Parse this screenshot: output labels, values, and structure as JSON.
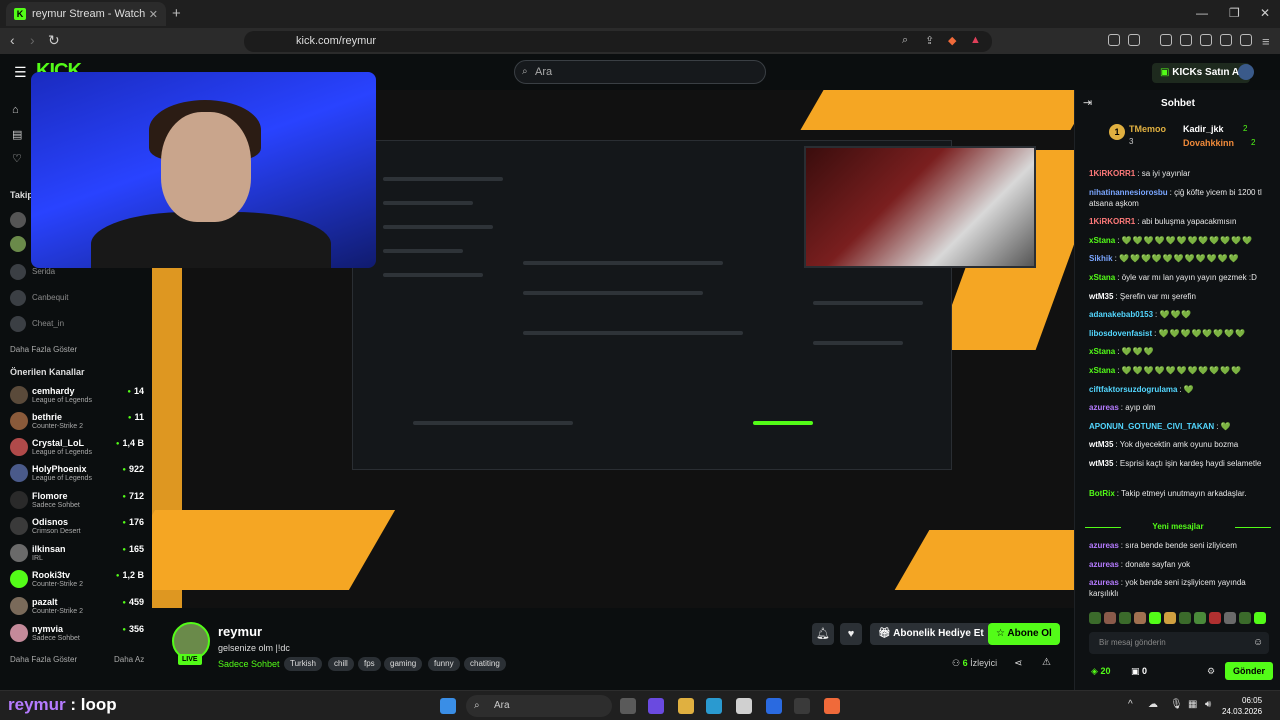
{
  "browser": {
    "tab_title": "reymur Stream - Watch Live on K",
    "url": "kick.com/reymur"
  },
  "header": {
    "logo": "KICK",
    "search_placeholder": "Ara",
    "kicks_button": "KICKs Satın Al"
  },
  "sidebar": {
    "following_title": "Takip",
    "offline_channels": [
      "Serida",
      "Canbequit",
      "Cheat_in"
    ],
    "show_more": "Daha Fazla Göster",
    "recommended_title": "Önerilen Kanallar",
    "recommended": [
      {
        "name": "cemhardy",
        "category": "League of Legends",
        "viewers": "14",
        "color": "#5a4a3a"
      },
      {
        "name": "bethrie",
        "category": "Counter-Strike 2",
        "viewers": "11",
        "color": "#8a5a3a"
      },
      {
        "name": "Crystal_LoL",
        "category": "League of Legends",
        "viewers": "1,4 B",
        "color": "#b04a4a"
      },
      {
        "name": "HolyPhoenix",
        "category": "League of Legends",
        "viewers": "922",
        "color": "#4a5a8a"
      },
      {
        "name": "Flomore",
        "category": "Sadece Sohbet",
        "viewers": "712",
        "color": "#2a2a2a"
      },
      {
        "name": "Odisnos",
        "category": "Crimson Desert",
        "viewers": "176",
        "color": "#3a3a3a"
      },
      {
        "name": "ilkinsan",
        "category": "IRL",
        "viewers": "165",
        "color": "#6a6a6a"
      },
      {
        "name": "Rooki3tv",
        "category": "Counter-Strike 2",
        "viewers": "1,2 B",
        "color": "#53fc18"
      },
      {
        "name": "pazalt",
        "category": "Counter-Strike 2",
        "viewers": "459",
        "color": "#7a6a5a"
      },
      {
        "name": "nymvia",
        "category": "Sadece Sohbet",
        "viewers": "356",
        "color": "#c48a9a"
      }
    ],
    "show_more_2": "Daha Fazla Göster",
    "show_less": "Daha Az"
  },
  "stream": {
    "streamer": "reymur",
    "live_badge": "LIVE",
    "title": "gelsenize olm |!dc",
    "category": "Sadece Sohbet",
    "tags": [
      "Turkish",
      "chill",
      "fps",
      "gaming",
      "funny",
      "chatiting"
    ],
    "gift_button": "Abonelik Hediye Et",
    "subscribe_button": "Abone Ol",
    "viewer_count": "6",
    "viewer_label": "İzleyici"
  },
  "chat": {
    "title": "Sohbet",
    "pinned": {
      "leader": "TMemoo",
      "leader_count": "3",
      "users": [
        {
          "name": "Kadir_jkk",
          "count": "2"
        },
        {
          "name": "Dovahkkinn",
          "count": "2"
        }
      ]
    },
    "messages": [
      {
        "user": "1KiRKORR1",
        "text": "sa iyi yayınlar",
        "color": "#ff7a7a"
      },
      {
        "user": "nihatinannesiorosbu",
        "text": "çiğ köfte yicem bi 1200 tl atsana aşkom",
        "color": "#7aa6ff"
      },
      {
        "user": "1KiRKORR1",
        "text": "abi buluşma yapacakmısın",
        "color": "#ff7a7a"
      },
      {
        "user": "xStana",
        "text": "💚💚💚💚💚💚💚💚💚💚💚💚",
        "color": "#53fc18"
      },
      {
        "user": "Sikhik",
        "text": "💚💚💚💚💚💚💚💚💚💚💚",
        "color": "#7aa6ff"
      },
      {
        "user": "xStana",
        "text": "öyle var mı lan yayın yayın gezmek :D",
        "color": "#53fc18"
      },
      {
        "user": "wtM35",
        "text": "Şerefin var mı şerefin",
        "color": "#ffffff"
      },
      {
        "user": "adanakebab0153",
        "text": "💚💚💚",
        "color": "#53d7ff"
      },
      {
        "user": "libosdovenfasist",
        "text": "💚💚💚💚💚💚💚💚",
        "color": "#53d7ff"
      },
      {
        "user": "xStana",
        "text": "💚💚💚",
        "color": "#53fc18"
      },
      {
        "user": "xStana",
        "text": "💚💚💚💚💚💚💚💚💚💚💚",
        "color": "#53fc18"
      },
      {
        "user": "ciftfaktorsuzdogrulama",
        "text": "💚",
        "color": "#53d7ff"
      },
      {
        "user": "azureas",
        "text": "ayıp olm",
        "color": "#b57bff"
      },
      {
        "user": "APONUN_GOTUNE_CIVI_TAKAN",
        "text": "💚",
        "color": "#53d7ff"
      },
      {
        "user": "wtM35",
        "text": "Yok diyecektin amk oyunu bozma",
        "color": "#ffffff"
      },
      {
        "user": "wtM35",
        "text": "Esprisi kaçtı işin kardeş haydi selametle",
        "color": "#ffffff"
      },
      {
        "user": "BotRix",
        "text": "Takip etmeyi unutmayın arkadaşlar.",
        "color": "#53fc18"
      }
    ],
    "new_messages_label": "Yeni mesajlar",
    "new_messages": [
      {
        "user": "azureas",
        "text": "sıra bende bende seni izliyicem",
        "color": "#b57bff"
      },
      {
        "user": "azureas",
        "text": "donate sayfan yok",
        "color": "#b57bff"
      },
      {
        "user": "azureas",
        "text": "yok bende seni izşliyicem yayında karşılıklı",
        "color": "#b57bff"
      }
    ],
    "input_placeholder": "Bir mesaj gönderin",
    "kicks_count": "20",
    "points": "0",
    "send_button": "Gönder"
  },
  "overlay": {
    "name": "reymur",
    "suffix": ": loop"
  },
  "taskbar": {
    "search": "Ara",
    "time": "06:05",
    "date": "24.03.2026"
  }
}
